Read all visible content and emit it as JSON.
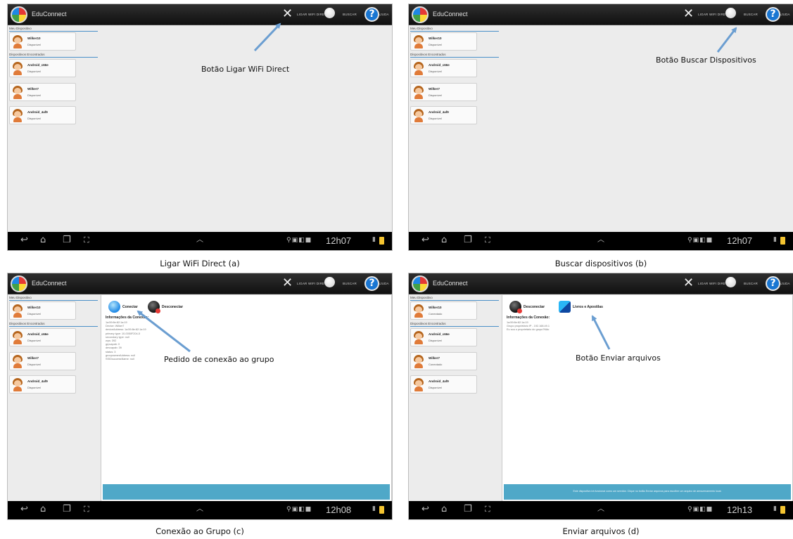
{
  "app": {
    "title": "EduConnect",
    "actions": {
      "ligar_label": "LIGAR WIFI DIRECT",
      "buscar_label": "BUSCAR",
      "ajuda_label": "AJUDA"
    },
    "icons": [
      "eduConnect-logo-icon",
      "tools-icon",
      "search-icon",
      "help-icon"
    ]
  },
  "panels": {
    "a": {
      "caption": "Ligar WiFi Direct (a)",
      "annotation": "Botão Ligar WiFi Direct",
      "my_device_header": "Meu Dispositivo",
      "found_header": "Dispositivos Encontrados",
      "my_device": {
        "name": "Wilker10",
        "status": "Disponível"
      },
      "devices": [
        {
          "name": "Android_c66e",
          "status": "Disponível"
        },
        {
          "name": "Wilker7",
          "status": "Disponível"
        },
        {
          "name": "Android_4af9",
          "status": "Disponível"
        }
      ],
      "time": "12h07"
    },
    "b": {
      "caption": "Buscar dispositivos (b)",
      "annotation": "Botão Buscar Dispositivos",
      "my_device_header": "Meu Dispositivo",
      "found_header": "Dispositivos Encontrados",
      "my_device": {
        "name": "Wilker10",
        "status": "Disponível"
      },
      "devices": [
        {
          "name": "Android_c66e",
          "status": "Disponível"
        },
        {
          "name": "Wilker7",
          "status": "Disponível"
        },
        {
          "name": "Android_4af9",
          "status": "Disponível"
        }
      ],
      "time": "12h07"
    },
    "c": {
      "caption": "Conexão ao Grupo (c)",
      "annotation": "Pedido de conexão ao grupo",
      "my_device_header": "Meu Dispositivo",
      "found_header": "Dispositivos Encontrados",
      "my_device": {
        "name": "Wilker10",
        "status": "Disponível"
      },
      "devices": [
        {
          "name": "Android_c66e",
          "status": "Disponível"
        },
        {
          "name": "Wilker7",
          "status": "Disponível"
        },
        {
          "name": "Android_4af9",
          "status": "Disponível"
        }
      ],
      "connect_label": "Conectar",
      "disconnect_label": "Desconectar",
      "info_title": "Informações da Conexão:",
      "info_lines": [
        "1a:59:8e:82:1a:19",
        "Device: Wilker7",
        "deviceAddress: 1a:59:8e:82:1a:19",
        "primary type: 10-0050F204-5",
        "secondary type: null",
        "wps: 392",
        "grpcapab: 0",
        "devcapab: 39",
        "status: 3",
        "groupownerAddress: null",
        "SSIDsuccessName: null"
      ],
      "time": "12h08"
    },
    "d": {
      "caption": "Enviar arquivos (d)",
      "annotation": "Botão Enviar arquivos",
      "my_device_header": "Meu Dispositivo",
      "found_header": "Dispositivos Encontrados",
      "my_device": {
        "name": "Wilker10",
        "status": "Conectado"
      },
      "devices": [
        {
          "name": "Android_c66e",
          "status": "Disponível"
        },
        {
          "name": "Wilker7",
          "status": "Conectado"
        },
        {
          "name": "Android_4af9",
          "status": "Disponível"
        }
      ],
      "disconnect_label": "Desconectar",
      "files_label": "Livros e Apostilas",
      "info_title": "Informações da Conexão:",
      "info_lines": [
        "1a:59:8e:82:1a:19",
        "Grupo proprietário IP - 192.168.49.1",
        "Eu sou o proprietário do grupo?Não"
      ],
      "footer_text": "Este dispositivo irá funcionar como um servidor. Clique no botão Enviar arquivos para escolher um arquivo de armazenamento local.",
      "time": "12h13"
    }
  },
  "colors": {
    "actionbar": "#1a1a1a",
    "accent_blue": "#4a90c8",
    "footer_bar": "#4fa8c8",
    "annotation_arrow": "#6b9ed1"
  }
}
